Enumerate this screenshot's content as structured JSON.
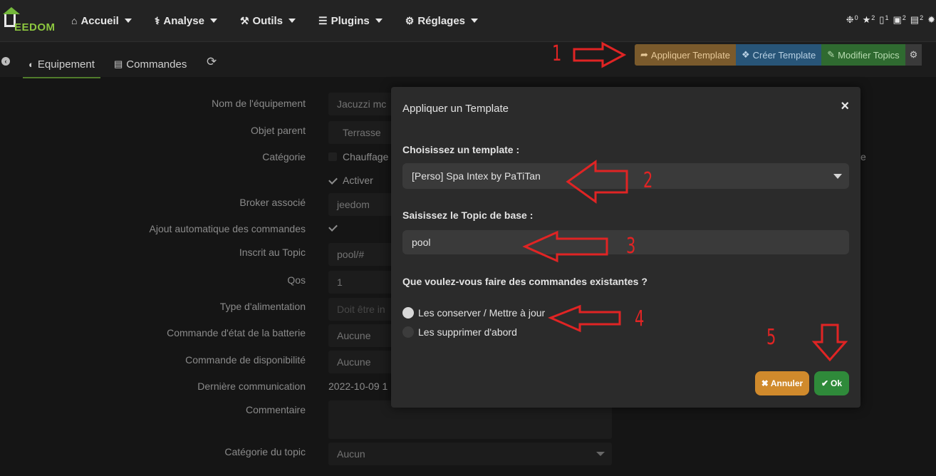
{
  "logo": {
    "text": "EEDOM"
  },
  "nav": {
    "items": [
      {
        "label": "Accueil",
        "icon": "home-icon",
        "glyph": "⌂"
      },
      {
        "label": "Analyse",
        "icon": "stethoscope-icon",
        "glyph": "⚕"
      },
      {
        "label": "Outils",
        "icon": "wrench-icon",
        "glyph": "⚒"
      },
      {
        "label": "Plugins",
        "icon": "tasks-icon",
        "glyph": "☰"
      },
      {
        "label": "Réglages",
        "icon": "gear-icon",
        "glyph": "⚙"
      }
    ],
    "status": [
      {
        "icon": "alarm-icon",
        "glyph": "❉",
        "count": "0"
      },
      {
        "icon": "motion-icon",
        "glyph": "★",
        "count": "2"
      },
      {
        "icon": "door-icon",
        "glyph": "▯",
        "count": "1"
      },
      {
        "icon": "window-icon",
        "glyph": "▣",
        "count": "2"
      },
      {
        "icon": "shutter-icon",
        "glyph": "▤",
        "count": "2"
      },
      {
        "icon": "light-icon",
        "glyph": "✹",
        "count": ""
      }
    ]
  },
  "tabs": {
    "equipement": "Equipement",
    "commandes": "Commandes"
  },
  "toolbar": {
    "apply_template": "Appliquer Template",
    "create_template": "Créer Template",
    "modify_topics": "Modifier Topics"
  },
  "form": {
    "nom_label": "Nom de l'équipement",
    "nom_value": "Jacuzzi mc",
    "objet_label": "Objet parent",
    "objet_value": "Terrasse",
    "categorie_label": "Catégorie",
    "categorie_value": "Chauffage",
    "categorie_right": "e",
    "activer_label": "Activer",
    "broker_label": "Broker associé",
    "broker_value": "jeedom",
    "ajout_label": "Ajout automatique des commandes",
    "inscrit_label": "Inscrit au Topic",
    "inscrit_value": "pool/#",
    "qos_label": "Qos",
    "qos_value": "1",
    "alim_label": "Type d'alimentation",
    "alim_placeholder": "Doit être in",
    "batterie_label": "Commande d'état de la batterie",
    "batterie_value": "Aucune",
    "dispo_label": "Commande de disponibilité",
    "dispo_value": "Aucune",
    "derniere_label": "Dernière communication",
    "derniere_value": "2022-10-09 1",
    "commentaire_label": "Commentaire",
    "cat_topic_label": "Catégorie du topic",
    "cat_topic_value": "Aucun"
  },
  "modal": {
    "title": "Appliquer un Template",
    "choose_label": "Choisissez un template :",
    "template_selected": "[Perso] Spa Intex by PaTiTan",
    "topic_label": "Saisissez le Topic de base :",
    "topic_value": "pool",
    "question": "Que voulez-vous faire des commandes existantes ?",
    "option_keep": "Les conserver / Mettre à jour",
    "option_delete": "Les supprimer d'abord",
    "selected_option": "keep",
    "cancel_label": "Annuler",
    "ok_label": "Ok"
  },
  "annotations": {
    "n1": "1",
    "n2": "2",
    "n3": "3",
    "n4": "4",
    "n5": "5",
    "color": "#e02424"
  }
}
